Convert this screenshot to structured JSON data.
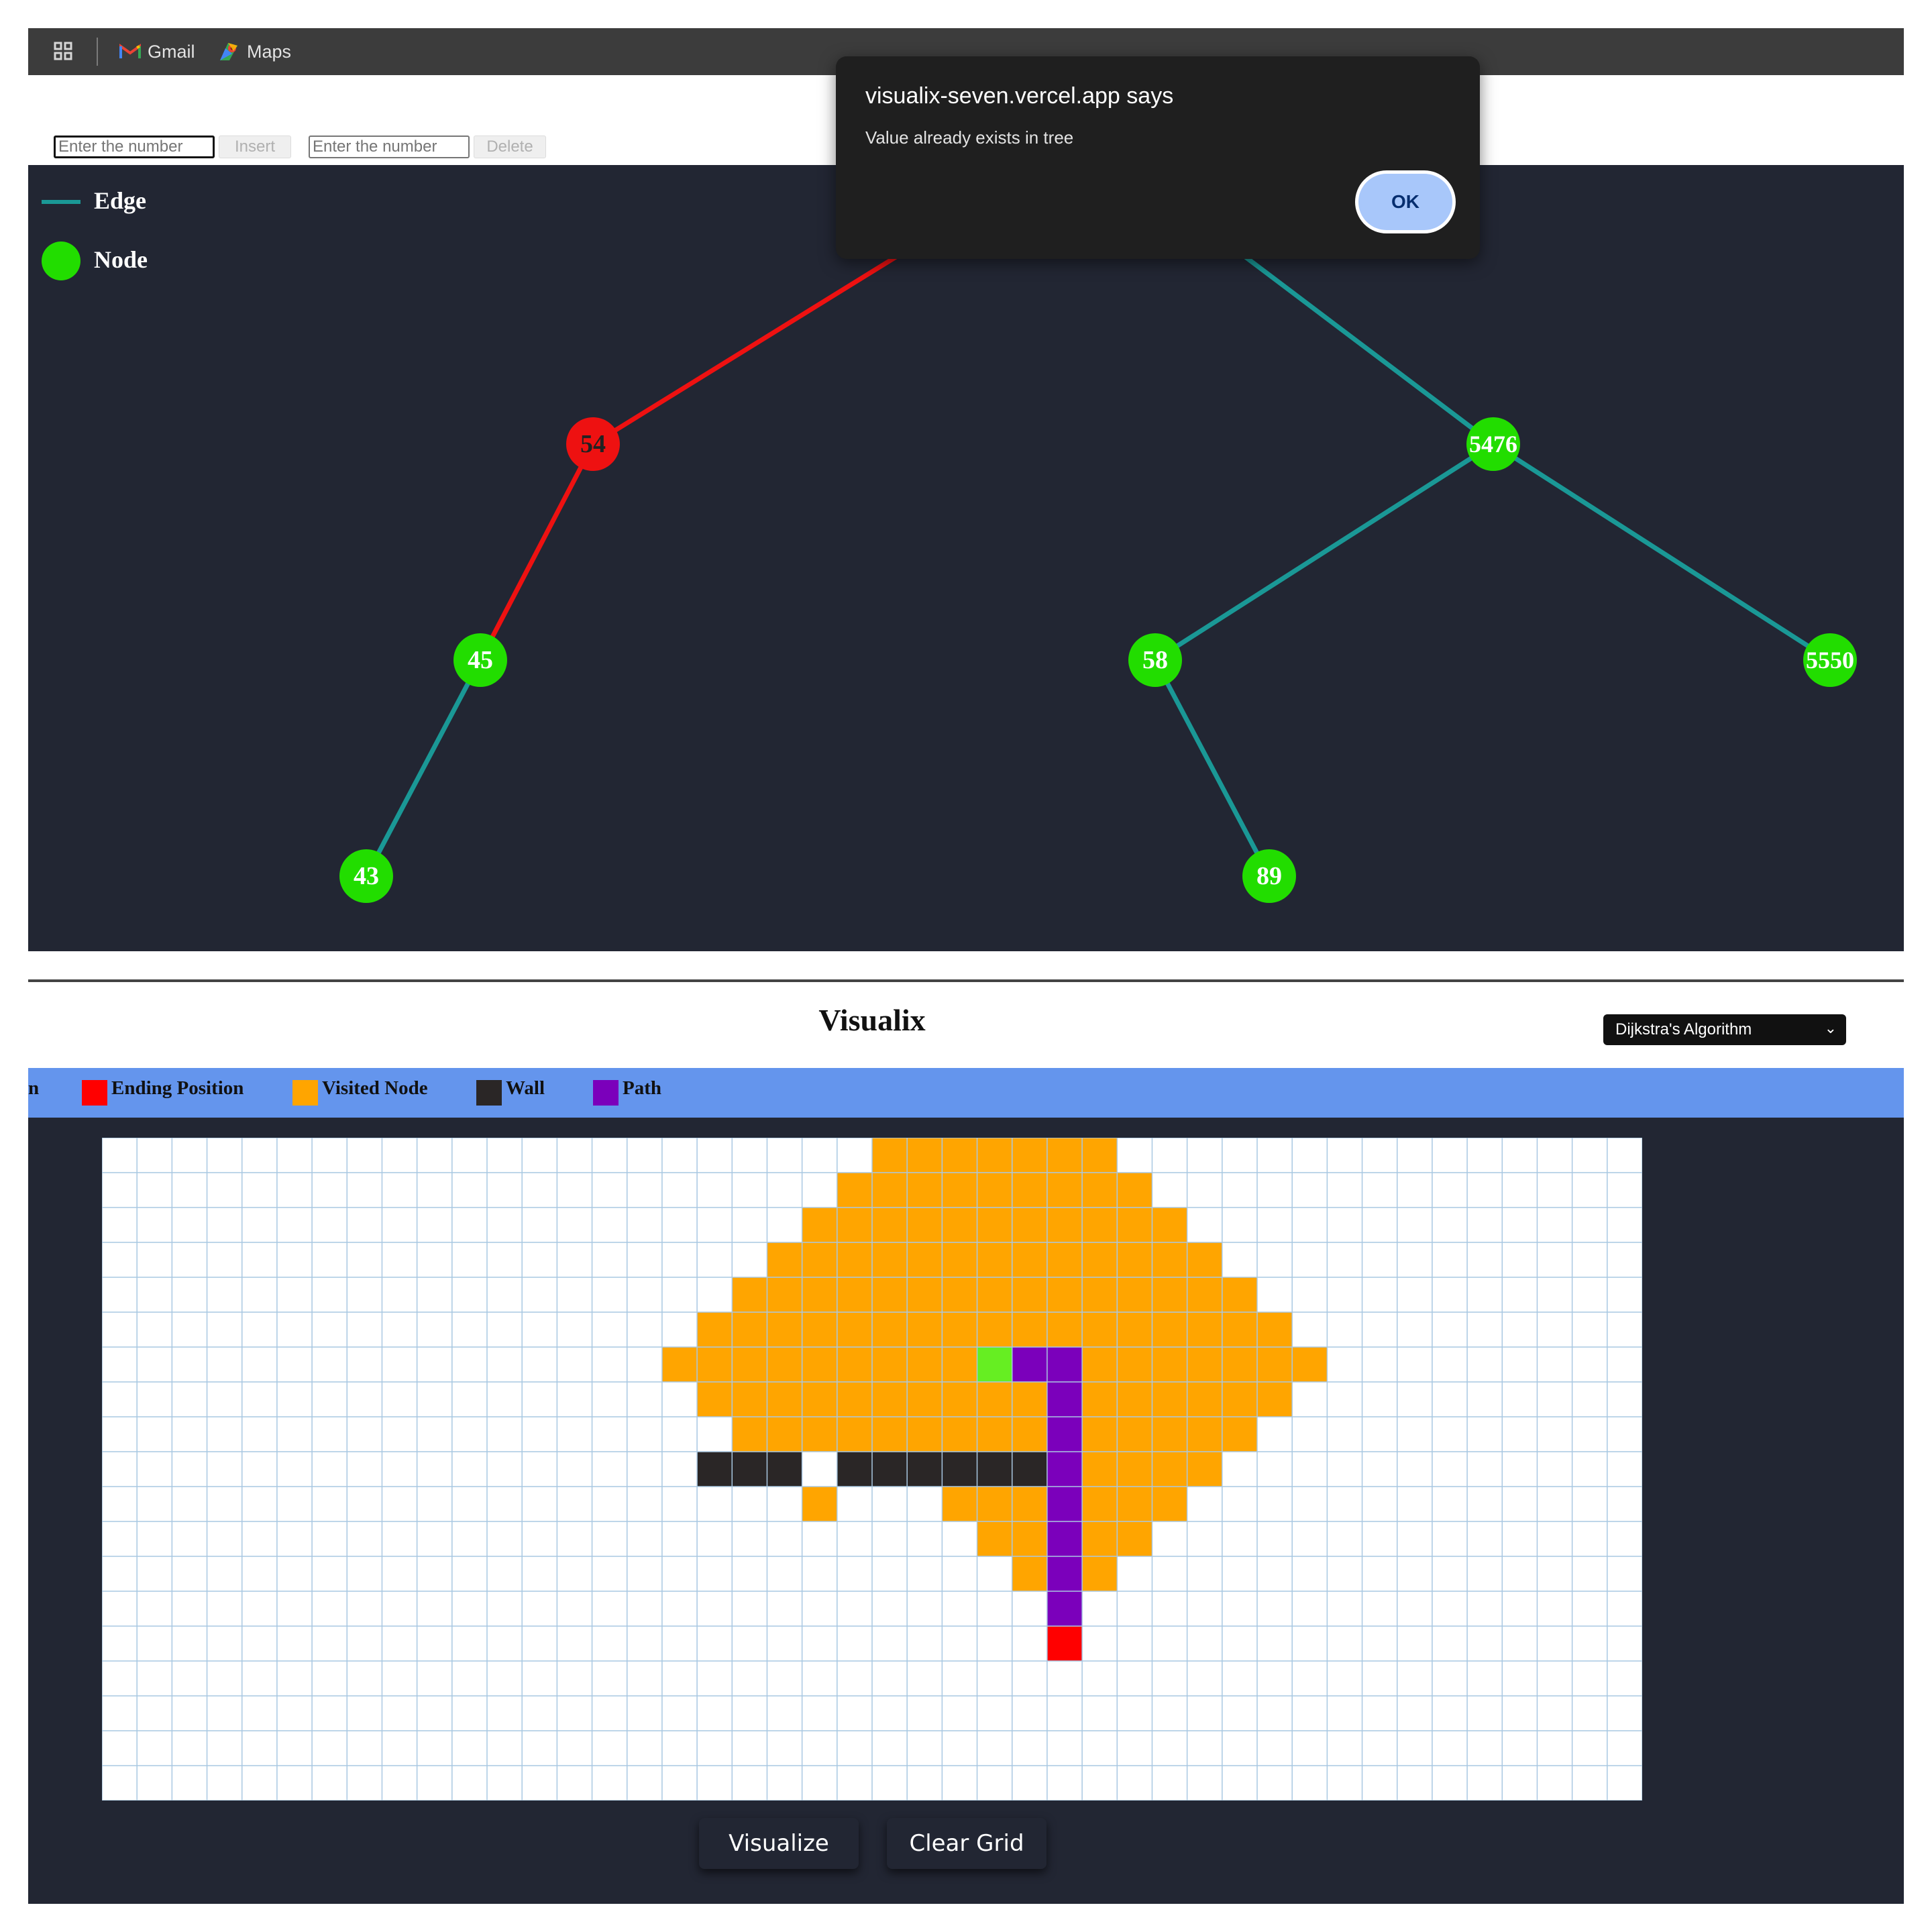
{
  "bookmarks_bar": {
    "apps_icon": "apps-grid-icon",
    "items": [
      {
        "label": "Gmail",
        "icon": "gmail-icon"
      },
      {
        "label": "Maps",
        "icon": "maps-icon"
      }
    ]
  },
  "bst_controls": {
    "insert_placeholder": "Enter the number",
    "insert_label": "Insert",
    "delete_placeholder": "Enter the number",
    "delete_label": "Delete"
  },
  "tree_legend": {
    "edge_label": "Edge",
    "node_label": "Node"
  },
  "tree": {
    "node_color": "#22dd00",
    "highlight_color": "#ee1111",
    "edge_color": "#1a9896",
    "nodes": [
      {
        "id": "n54",
        "label": "54",
        "highlighted": true
      },
      {
        "id": "n5476",
        "label": "5476",
        "highlighted": false
      },
      {
        "id": "n45",
        "label": "45",
        "highlighted": false
      },
      {
        "id": "n58",
        "label": "58",
        "highlighted": false
      },
      {
        "id": "n5550",
        "label": "5550",
        "highlighted": false
      },
      {
        "id": "n43",
        "label": "43",
        "highlighted": false
      },
      {
        "id": "n89",
        "label": "89",
        "highlighted": false
      }
    ],
    "edges": [
      {
        "from": "root",
        "to": "n54",
        "highlighted": true
      },
      {
        "from": "root",
        "to": "n5476",
        "highlighted": false
      },
      {
        "from": "n54",
        "to": "n45",
        "highlighted": true
      },
      {
        "from": "n45",
        "to": "n43",
        "highlighted": false
      },
      {
        "from": "n5476",
        "to": "n58",
        "highlighted": false
      },
      {
        "from": "n5476",
        "to": "n5550",
        "highlighted": false
      },
      {
        "from": "n58",
        "to": "n89",
        "highlighted": false
      }
    ]
  },
  "alert": {
    "title": "visualix-seven.vercel.app says",
    "message": "Value already exists in tree",
    "ok_label": "OK"
  },
  "visualix": {
    "title": "Visualix",
    "algorithm_selected": "Dijkstra's Algorithm",
    "legend": [
      {
        "label": "Ending Position",
        "color": "#ff0000"
      },
      {
        "label": "Visited Node",
        "color": "#ffa500"
      },
      {
        "label": "Wall",
        "color": "#2a2626"
      },
      {
        "label": "Path",
        "color": "#7b00bb"
      }
    ],
    "legend_clipped_text": "n",
    "grid": {
      "cols": 44,
      "rows": 19,
      "colors": {
        "empty": "#ffffff",
        "visited": "#ffa500",
        "wall": "#2a2626",
        "path": "#7b00bb",
        "start": "#66ee22",
        "end": "#ff0000",
        "line": "#a9c8e2"
      },
      "visited_runs": [
        [
          0,
          22,
          28
        ],
        [
          1,
          21,
          29
        ],
        [
          2,
          20,
          30
        ],
        [
          3,
          19,
          31
        ],
        [
          4,
          18,
          32
        ],
        [
          5,
          17,
          33
        ],
        [
          6,
          16,
          34
        ],
        [
          7,
          17,
          33
        ],
        [
          8,
          18,
          32
        ],
        [
          9,
          26,
          31
        ],
        [
          10,
          20,
          20
        ],
        [
          10,
          24,
          30
        ],
        [
          11,
          25,
          29
        ],
        [
          12,
          26,
          28
        ]
      ],
      "walls": [
        [
          9,
          17
        ],
        [
          9,
          18
        ],
        [
          9,
          19
        ],
        [
          9,
          21
        ],
        [
          9,
          22
        ],
        [
          9,
          23
        ],
        [
          9,
          24
        ],
        [
          9,
          25
        ],
        [
          9,
          26
        ]
      ],
      "path": [
        [
          6,
          26
        ],
        [
          6,
          27
        ],
        [
          7,
          27
        ],
        [
          8,
          27
        ],
        [
          9,
          27
        ],
        [
          10,
          27
        ],
        [
          11,
          27
        ],
        [
          12,
          27
        ],
        [
          13,
          27
        ]
      ],
      "start": [
        6,
        25
      ],
      "end": [
        14,
        27
      ]
    },
    "visualize_label": "Visualize",
    "clear_label": "Clear Grid"
  }
}
